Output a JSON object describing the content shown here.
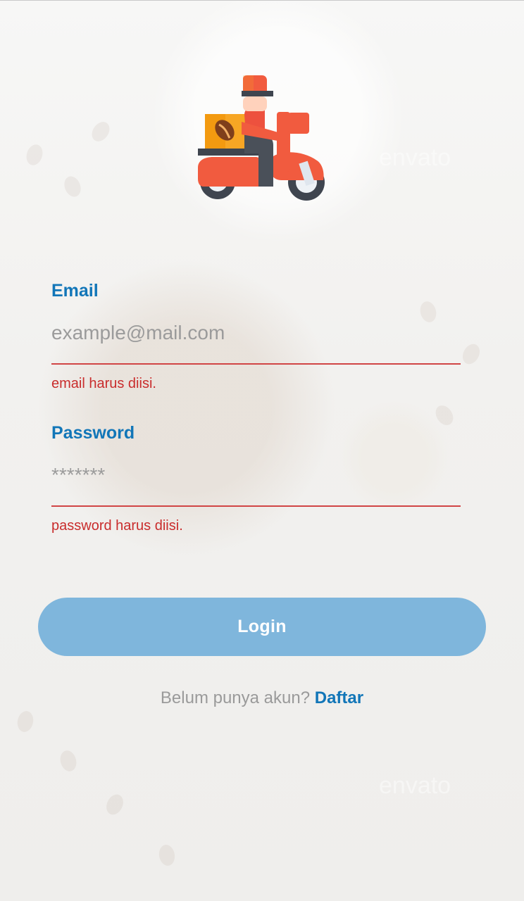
{
  "logo": {
    "icon": "delivery-scooter-icon"
  },
  "watermark": {
    "text": "envato"
  },
  "form": {
    "email": {
      "label": "Email",
      "placeholder": "example@mail.com",
      "value": "",
      "error": "email harus diisi."
    },
    "password": {
      "label": "Password",
      "placeholder": "*******",
      "value": "",
      "error": "password harus diisi."
    },
    "login_label": "Login"
  },
  "signup": {
    "prompt": "Belum punya akun?",
    "link_label": "Daftar"
  },
  "colors": {
    "accent": "#1276b8",
    "error": "#d14545",
    "button": "#7fb6dc",
    "logo_red": "#f15b3f",
    "logo_orange": "#f39c12"
  }
}
